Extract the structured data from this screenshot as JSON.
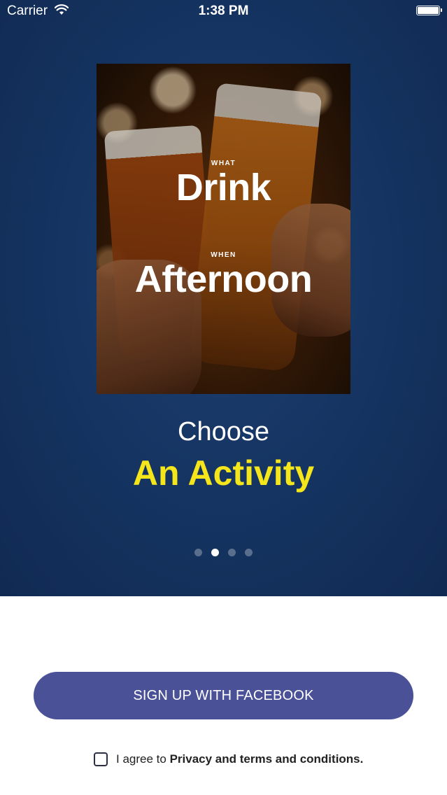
{
  "status_bar": {
    "carrier": "Carrier",
    "time": "1:38 PM",
    "wifi_icon": "wifi-icon",
    "battery_icon": "battery-icon"
  },
  "card": {
    "what_label": "WHAT",
    "activity_label": "Drink",
    "when_label": "WHEN",
    "time_label": "Afternoon",
    "image": "beer-glasses-toast-photo"
  },
  "headline": {
    "line1": "Choose",
    "line2": "An Activity",
    "accent_color": "#f4e61b"
  },
  "pagination": {
    "count": 4,
    "active_index": 1
  },
  "signup": {
    "facebook_button": "SIGN UP WITH FACEBOOK",
    "button_color": "#4a5197"
  },
  "terms": {
    "prefix": "I agree to ",
    "link": "Privacy and terms and conditions."
  }
}
